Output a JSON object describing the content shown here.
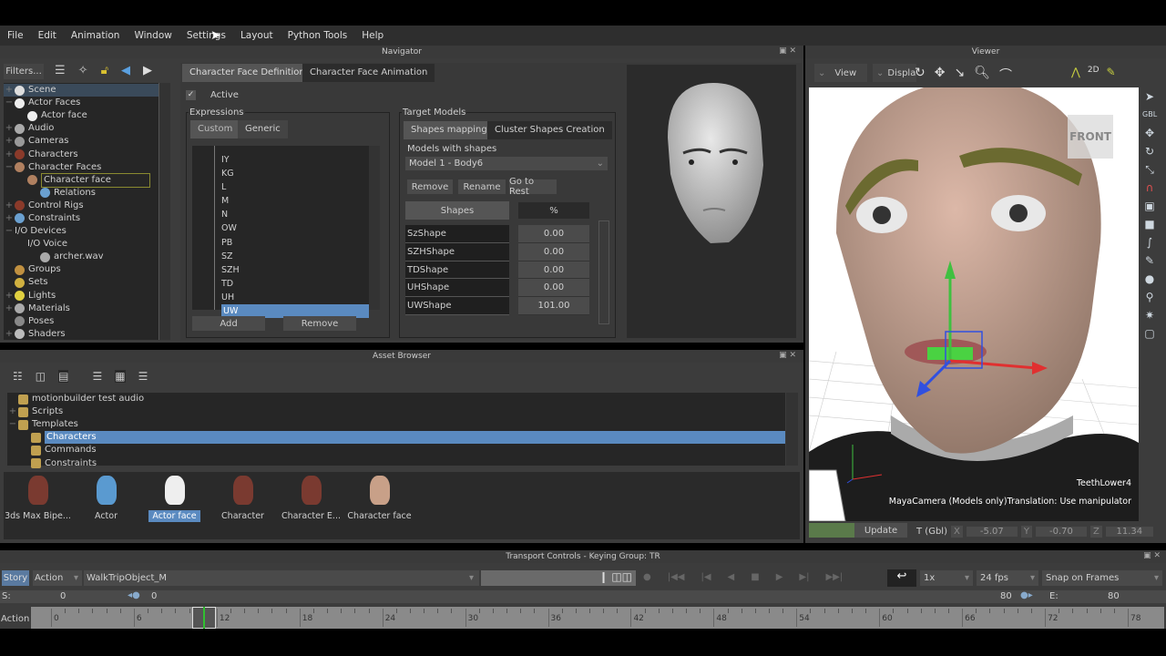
{
  "menu": [
    "File",
    "Edit",
    "Animation",
    "Window",
    "Settings",
    "Layout",
    "Python Tools",
    "Help"
  ],
  "navigator": {
    "title": "Navigator",
    "filters": "Filters...",
    "tree": [
      {
        "label": "Scene",
        "exp": "+",
        "color": "#ddd",
        "indent": 0,
        "selected": true
      },
      {
        "label": "Actor Faces",
        "exp": "−",
        "color": "#eee",
        "indent": 0
      },
      {
        "label": "Actor face",
        "exp": "",
        "color": "#eee",
        "indent": 1
      },
      {
        "label": "Audio",
        "exp": "+",
        "color": "#aaa",
        "indent": 0
      },
      {
        "label": "Cameras",
        "exp": "+",
        "color": "#999",
        "indent": 0
      },
      {
        "label": "Characters",
        "exp": "+",
        "color": "#8a3a2a",
        "indent": 0
      },
      {
        "label": "Character Faces",
        "exp": "−",
        "color": "#b08060",
        "indent": 0
      },
      {
        "label": "Character face",
        "exp": "",
        "color": "#b08060",
        "indent": 1,
        "outlined": true
      },
      {
        "label": "Relations",
        "exp": "",
        "color": "#6aa0d0",
        "indent": 2
      },
      {
        "label": "Control Rigs",
        "exp": "+",
        "color": "#8a3a2a",
        "indent": 0
      },
      {
        "label": "Constraints",
        "exp": "+",
        "color": "#6aa0d0",
        "indent": 0
      },
      {
        "label": "I/O Devices",
        "exp": "−",
        "color": "",
        "indent": 0
      },
      {
        "label": "I/O Voice",
        "exp": "",
        "color": "",
        "indent": 1
      },
      {
        "label": "archer.wav",
        "exp": "",
        "color": "#aaa",
        "indent": 2
      },
      {
        "label": "Groups",
        "exp": "",
        "color": "#c09040",
        "indent": 0
      },
      {
        "label": "Sets",
        "exp": "",
        "color": "#d0b040",
        "indent": 0
      },
      {
        "label": "Lights",
        "exp": "+",
        "color": "#e0d040",
        "indent": 0
      },
      {
        "label": "Materials",
        "exp": "+",
        "color": "#aaa",
        "indent": 0
      },
      {
        "label": "Poses",
        "exp": "",
        "color": "#888",
        "indent": 0
      },
      {
        "label": "Shaders",
        "exp": "+",
        "color": "#bbb",
        "indent": 0
      }
    ],
    "tabs": [
      "Character Face Definition",
      "Character Face Animation"
    ],
    "active_label": "Active",
    "active_checked": true,
    "expressions": {
      "title": "Expressions",
      "tabs": [
        "Custom",
        "Generic"
      ],
      "items": [
        "IY",
        "KG",
        "L",
        "M",
        "N",
        "OW",
        "PB",
        "SZ",
        "SZH",
        "TD",
        "UH",
        "UW"
      ],
      "selected": "UW",
      "add": "Add",
      "remove": "Remove"
    },
    "target_models": {
      "title": "Target Models",
      "tabs": [
        "Shapes mapping",
        "Cluster Shapes Creation"
      ],
      "models_label": "Models with shapes",
      "model": "Model 1 - Body6",
      "buttons": [
        "Remove",
        "Rename",
        "Go to Rest"
      ],
      "col_shapes": "Shapes",
      "col_pct": "%",
      "rows": [
        {
          "name": "SzShape",
          "value": "0.00"
        },
        {
          "name": "SZHShape",
          "value": "0.00"
        },
        {
          "name": "TDShape",
          "value": "0.00"
        },
        {
          "name": "UHShape",
          "value": "0.00"
        },
        {
          "name": "UWShape",
          "value": "101.00"
        }
      ]
    }
  },
  "asset_browser": {
    "title": "Asset Browser",
    "tree": [
      {
        "label": "motionbuilder test audio",
        "exp": "",
        "indent": 0
      },
      {
        "label": "Scripts",
        "exp": "+",
        "indent": 0
      },
      {
        "label": "Templates",
        "exp": "−",
        "indent": 0
      },
      {
        "label": "Characters",
        "exp": "",
        "indent": 1,
        "selected": true
      },
      {
        "label": "Commands",
        "exp": "",
        "indent": 1
      },
      {
        "label": "Constraints",
        "exp": "",
        "indent": 1
      }
    ],
    "items": [
      {
        "label": "3ds Max Bipe...",
        "icon": "biped-icon"
      },
      {
        "label": "Actor",
        "icon": "actor-icon"
      },
      {
        "label": "Actor face",
        "icon": "actor-face-icon",
        "selected": true
      },
      {
        "label": "Character",
        "icon": "character-icon"
      },
      {
        "label": "Character E...",
        "icon": "character-extension-icon"
      },
      {
        "label": "Character face",
        "icon": "character-face-icon"
      }
    ]
  },
  "viewer": {
    "title": "Viewer",
    "view": "View",
    "display": "Display",
    "front_label": "FRONT",
    "gbl": "GBL",
    "model_name": "TeethLower4",
    "status": "MayaCamera (Models only)Translation: Use manipulator",
    "update": "Update",
    "t_label": "T (Gbl)",
    "x_label": "X",
    "x": "-5.07",
    "y_label": "Y",
    "y": "-0.70",
    "z_label": "Z",
    "z": "11.34",
    "twod": "2D"
  },
  "transport": {
    "title": "Transport Controls  -  Keying Group: TR",
    "story": "Story",
    "mode": "Action",
    "take": "WalkTripObject_M",
    "speed": "1x",
    "fps": "24 fps",
    "snap": "Snap on Frames",
    "s_label": "S:",
    "start": "0",
    "slider_start": "0",
    "slider_end": "80",
    "e_label": "E:",
    "end": "80",
    "track_label": "Action",
    "ticks": [
      "0",
      "6",
      "12",
      "18",
      "24",
      "30",
      "36",
      "42",
      "48",
      "54",
      "60",
      "66",
      "72",
      "78"
    ],
    "current_frame": 11
  }
}
